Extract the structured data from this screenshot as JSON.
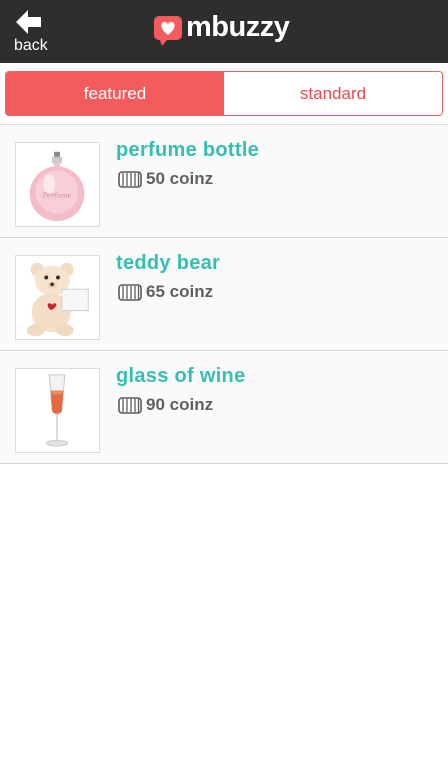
{
  "header": {
    "back_label": "back",
    "logo_text": "mbuzzy",
    "back_icon": "back-arrow-icon",
    "logo_icon": "heart-logo-icon"
  },
  "tabs": [
    {
      "label": "featured",
      "active": true
    },
    {
      "label": "standard",
      "active": false
    }
  ],
  "gifts": [
    {
      "name": "perfume bottle",
      "price": "50 coinz",
      "image": "perfume-bottle-image"
    },
    {
      "name": "teddy bear",
      "price": "65 coinz",
      "image": "teddy-bear-image"
    },
    {
      "name": "glass of wine",
      "price": "90 coinz",
      "image": "wine-glass-image"
    }
  ],
  "colors": {
    "topbar": "#2e2e2e",
    "accent_red": "#f45b5c",
    "teal": "#35bfb2",
    "price_gray": "#606060"
  }
}
